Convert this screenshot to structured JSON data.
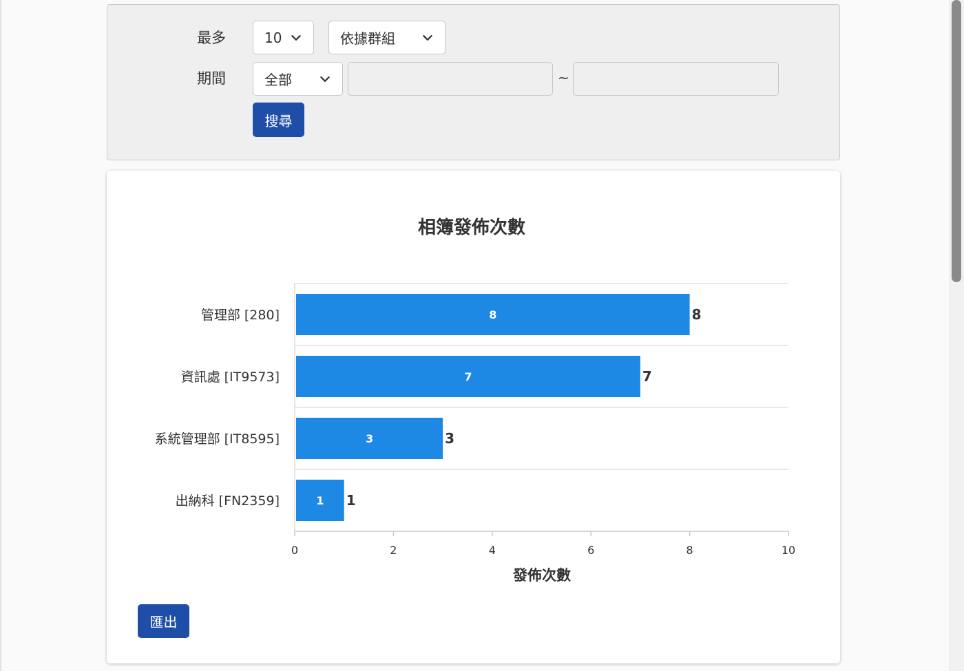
{
  "filters": {
    "max_label": "最多",
    "max_value": "10",
    "group_value": "依據群組",
    "period_label": "期間",
    "period_value": "全部",
    "date_from": "",
    "date_to": "",
    "range_separator": "~",
    "search_button": "搜尋"
  },
  "export_button": "匯出",
  "colors": {
    "bar": "#1e88e5",
    "button": "#1f4ea8"
  },
  "icons": {
    "select_arrow": "chevron-down-icon"
  },
  "chart_data": {
    "type": "bar",
    "orientation": "horizontal",
    "title": "相簿發佈次數",
    "xlabel": "發佈次數",
    "ylabel": "",
    "categories": [
      "管理部 [280]",
      "資訊處 [IT9573]",
      "系統管理部 [IT8595]",
      "出納科 [FN2359]"
    ],
    "values": [
      8,
      7,
      3,
      1
    ],
    "xlim": [
      0,
      10
    ],
    "xticks": [
      0,
      2,
      4,
      6,
      8,
      10
    ],
    "data_labels": true,
    "grid": true,
    "legend": "none"
  }
}
